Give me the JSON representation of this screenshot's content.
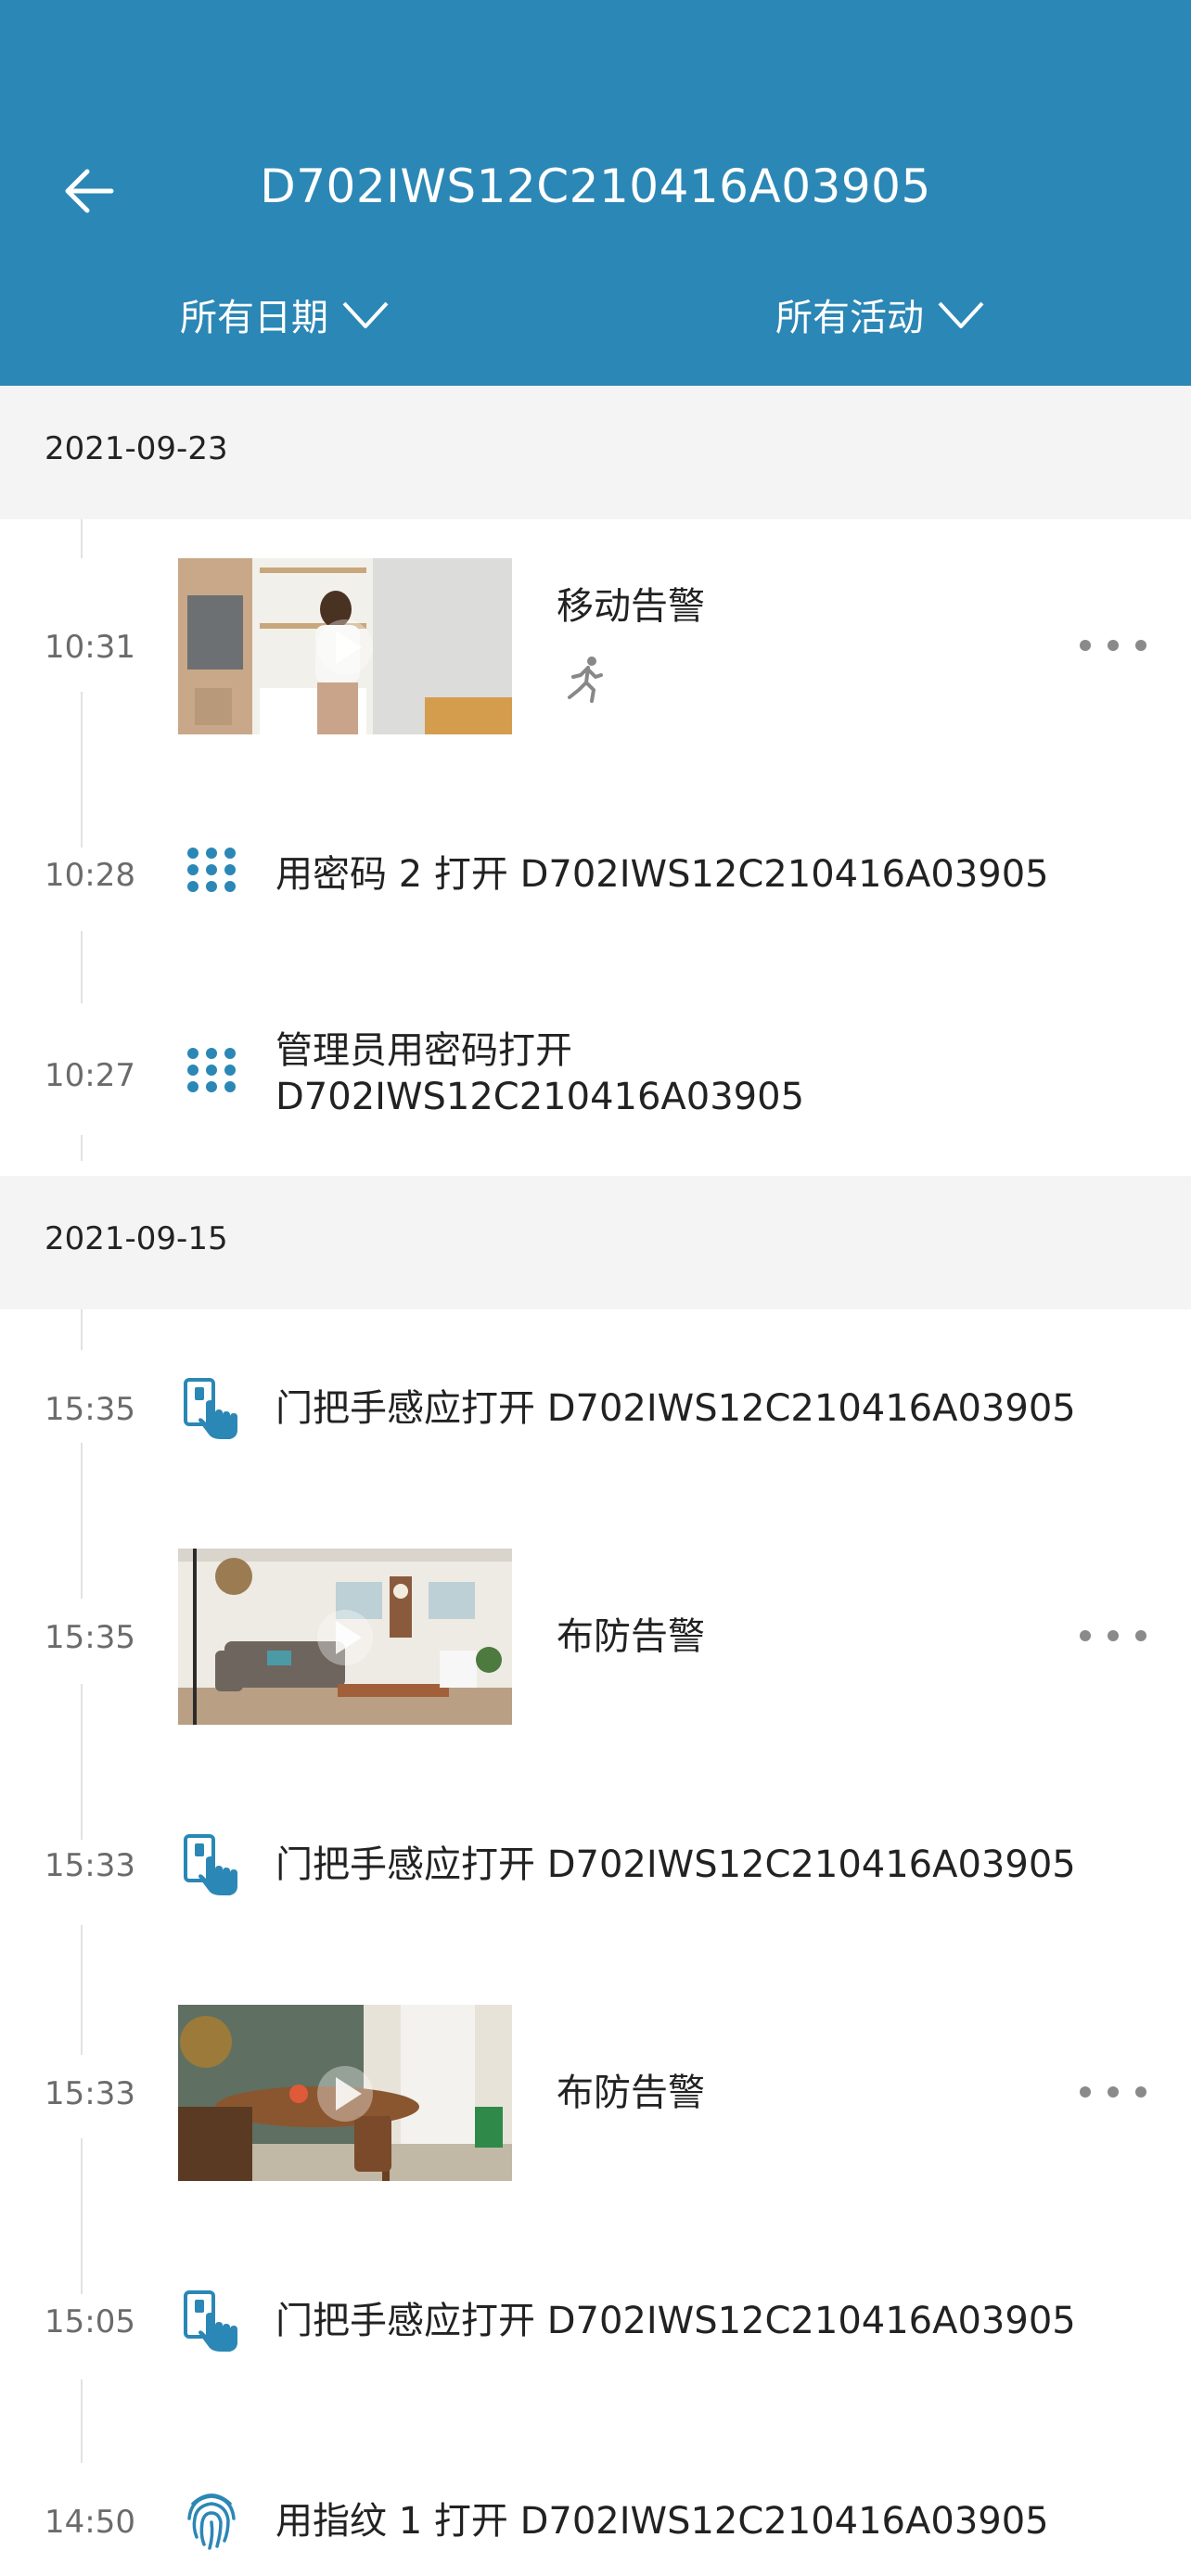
{
  "header": {
    "title": "D702IWS12C210416A03905",
    "filter_date": "所有日期",
    "filter_activity": "所有活动",
    "color": "#2b87b5"
  },
  "groups": [
    {
      "date": "2021-09-23",
      "events": [
        {
          "time": "10:31",
          "kind": "video",
          "label": "移动告警",
          "icon": "running-person-icon"
        },
        {
          "time": "10:28",
          "kind": "icon",
          "label": "用密码 2 打开 D702IWS12C210416A03905",
          "icon": "keypad-icon"
        },
        {
          "time": "10:27",
          "kind": "icon",
          "label_line1": "管理员用密码打开",
          "label_line2": "D702IWS12C210416A03905",
          "icon": "keypad-icon"
        }
      ]
    },
    {
      "date": "2021-09-15",
      "events": [
        {
          "time": "15:35",
          "kind": "icon",
          "label": "门把手感应打开 D702IWS12C210416A03905",
          "icon": "hand-touch-icon"
        },
        {
          "time": "15:35",
          "kind": "video",
          "label": "布防告警"
        },
        {
          "time": "15:33",
          "kind": "icon",
          "label": "门把手感应打开 D702IWS12C210416A03905",
          "icon": "hand-touch-icon"
        },
        {
          "time": "15:33",
          "kind": "video",
          "label": "布防告警"
        },
        {
          "time": "15:05",
          "kind": "icon",
          "label": "门把手感应打开 D702IWS12C210416A03905",
          "icon": "hand-touch-icon"
        },
        {
          "time": "14:50",
          "kind": "icon",
          "label": "用指纹 1 打开 D702IWS12C210416A03905",
          "icon": "fingerprint-icon"
        }
      ]
    }
  ]
}
